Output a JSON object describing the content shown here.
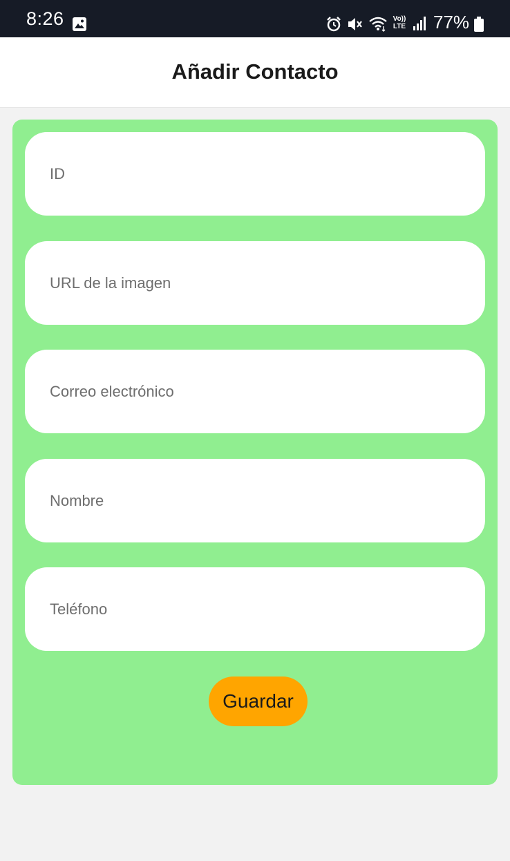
{
  "status_bar": {
    "time": "8:26",
    "volte_line1": "Vo))",
    "volte_line2": "LTE",
    "battery": "77%",
    "icons": [
      "gallery-icon",
      "alarm-icon",
      "mute-icon",
      "wifi-icon",
      "volte-icon",
      "signal-icon",
      "battery-icon"
    ]
  },
  "app_bar": {
    "title": "Añadir Contacto"
  },
  "form": {
    "fields": [
      {
        "name": "id",
        "value": "",
        "placeholder": "ID"
      },
      {
        "name": "image_url",
        "value": "",
        "placeholder": "URL de la imagen"
      },
      {
        "name": "email",
        "value": "",
        "placeholder": "Correo electrónico"
      },
      {
        "name": "name",
        "value": "",
        "placeholder": "Nombre"
      },
      {
        "name": "phone",
        "value": "",
        "placeholder": "Teléfono"
      }
    ],
    "save_label": "Guardar"
  },
  "colors": {
    "status_bar_bg": "#161b26",
    "form_card_bg": "#90ee90",
    "save_button_bg": "#ffa500",
    "page_bg": "#f2f2f2"
  }
}
